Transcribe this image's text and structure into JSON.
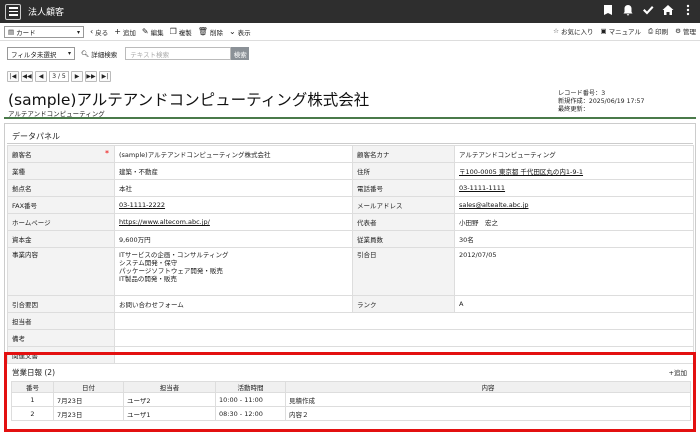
{
  "app": {
    "title": "法人顧客"
  },
  "toolbar": {
    "view_select": "カード",
    "back": "戻る",
    "add": "追加",
    "edit": "編集",
    "copy": "複製",
    "delete": "削除",
    "display": "表示",
    "favorites": "お気に入り",
    "manual": "マニュアル",
    "print": "印刷",
    "admin": "管理"
  },
  "search": {
    "filter_select": "フィルタ未選択",
    "advanced": "詳細検索",
    "placeholder": "テキスト検索",
    "button": "検索"
  },
  "pager": {
    "count": "3 / 5"
  },
  "record": {
    "title": "(sample)アルテアンドコンピューティング株式会社",
    "kana": "アルテアンドコンピューティング",
    "meta_line1": "レコード番号：3",
    "meta_line2": "新規作成：2025/06/19 17:57",
    "meta_line3": "最終更新："
  },
  "panel": {
    "title": "データパネル",
    "rows": [
      {
        "l1": "顧客名",
        "v1": "(sample)アルテアンドコンピューティング株式会社",
        "l2": "顧客名カナ",
        "v2": "アルテアンドコンピューティング"
      },
      {
        "l1": "業種",
        "v1": "建築・不動産",
        "l2": "住所",
        "v2": "〒100-0005 東京都 千代田区丸の内1-9-1"
      },
      {
        "l1": "拠点名",
        "v1": "本社",
        "l2": "電話番号",
        "v2": "03-1111-1111"
      },
      {
        "l1": "FAX番号",
        "v1": "03-1111-2222",
        "l2": "メールアドレス",
        "v2": "sales@altealte.abc.jp"
      },
      {
        "l1": "ホームページ",
        "v1": "https://www.altecom.abc.jp/",
        "l2": "代表者",
        "v2": "小田野　宏之"
      },
      {
        "l1": "資本金",
        "v1": "9,600万円",
        "l2": "従業員数",
        "v2": "30名"
      },
      {
        "l1": "事業内容",
        "v1_lines": [
          "ITサービスの企画・コンサルティング",
          "システム開発・保守",
          "パッケージソフトウェア開発・販売",
          "IT製品の開発・販売"
        ],
        "l2": "引合日",
        "v2": "2012/07/05"
      },
      {
        "l1": "引合要因",
        "v1": "お問い合わせフォーム",
        "l2": "ランク",
        "v2": "A"
      },
      {
        "l1": "担当者"
      },
      {
        "l1": "備考"
      },
      {
        "l1": "関連文書"
      }
    ]
  },
  "daily_report": {
    "title": "営業日報 (2)",
    "add": "追加",
    "headers": [
      "番号",
      "日付",
      "担当者",
      "活動時間",
      "内容"
    ],
    "rows": [
      [
        "1",
        "7月23日",
        "ユーザ2",
        "10:00 - 11:00",
        "見積作成"
      ],
      [
        "2",
        "7月23日",
        "ユーザ1",
        "08:30 - 12:00",
        "内容２"
      ]
    ]
  }
}
